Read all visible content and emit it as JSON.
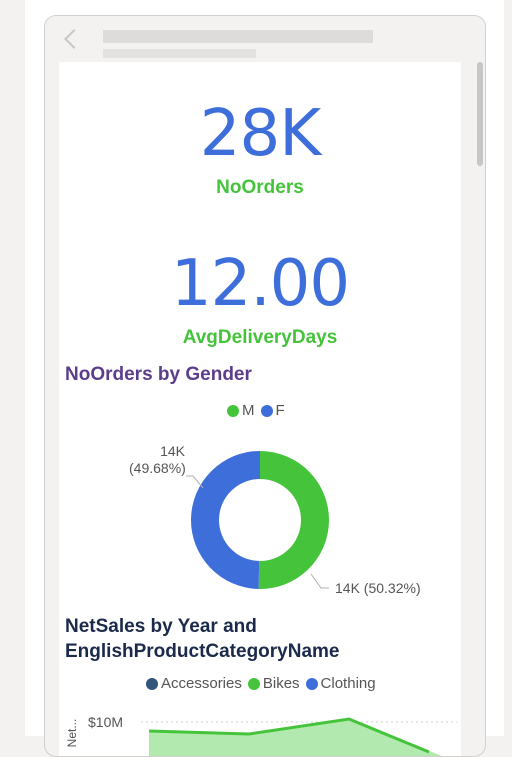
{
  "kpi_orders": {
    "value": "28K",
    "label": "NoOrders"
  },
  "kpi_delivery": {
    "value": "12.00",
    "label": "AvgDeliveryDays"
  },
  "gender_chart": {
    "title": "NoOrders by Gender",
    "legend": [
      {
        "name": "M",
        "color": "#45c43b"
      },
      {
        "name": "F",
        "color": "#3d6ed9"
      }
    ],
    "label_f_value": "14K",
    "label_f_pct": "(49.68%)",
    "label_m": "14K (50.32%)"
  },
  "sales_chart": {
    "title_line1": "NetSales by Year and",
    "title_line2": "EnglishProductCategoryName",
    "legend": [
      {
        "name": "Accessories",
        "color": "#34557a"
      },
      {
        "name": "Bikes",
        "color": "#45c43b"
      },
      {
        "name": "Clothing",
        "color": "#3d6ed9"
      }
    ],
    "y_axis_label": "Net...",
    "y_tick": "$10M"
  },
  "chart_data": [
    {
      "type": "pie",
      "title": "NoOrders by Gender",
      "categories": [
        "M",
        "F"
      ],
      "values": [
        50.32,
        49.68
      ],
      "data_labels": [
        "14K (50.32%)",
        "14K (49.68%)"
      ],
      "legend": "top-center",
      "colors": {
        "M": "#45c43b",
        "F": "#3d6ed9"
      }
    },
    {
      "type": "area",
      "title": "NetSales by Year and EnglishProductCategoryName",
      "series": [
        {
          "name": "Accessories"
        },
        {
          "name": "Bikes"
        },
        {
          "name": "Clothing"
        }
      ],
      "ylabel": "Net...",
      "y_ticks": [
        "$10M"
      ],
      "legend": "top-center"
    }
  ]
}
